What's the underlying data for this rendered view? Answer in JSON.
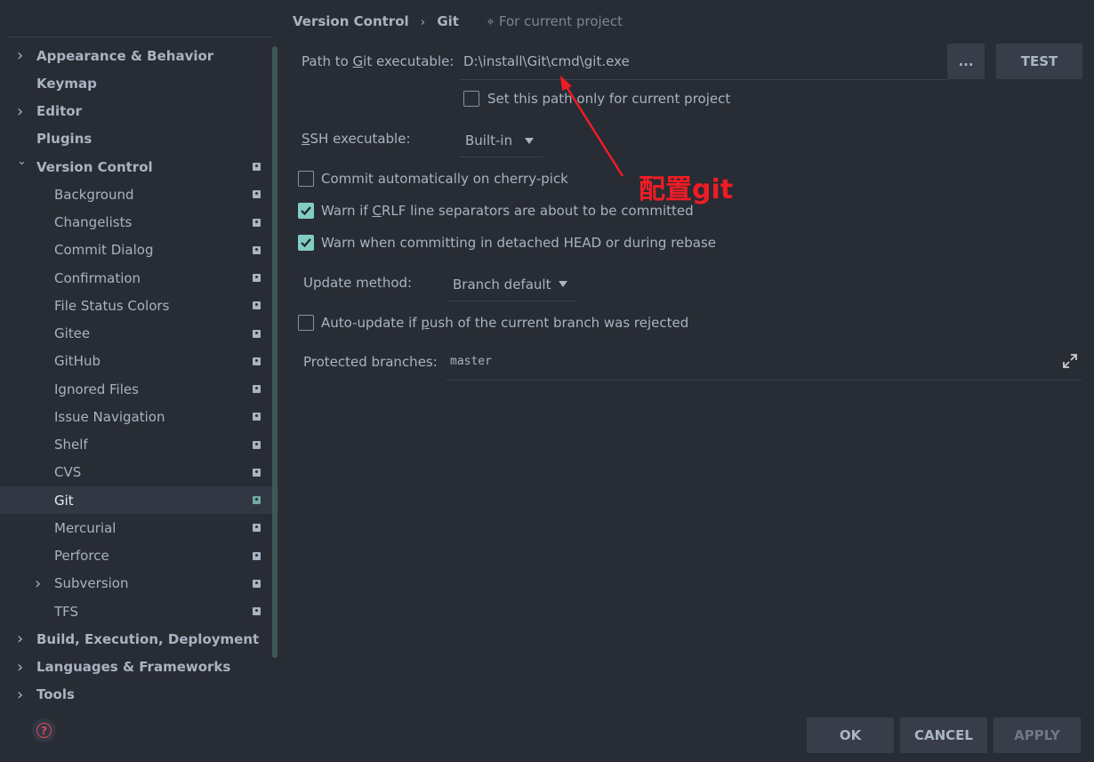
{
  "breadcrumb": {
    "parent": "Version Control",
    "separator": "›",
    "current": "Git",
    "scope": "For current project",
    "scope_icon": "project-scope-icon"
  },
  "sidebar": {
    "items": [
      {
        "label": "Appearance & Behavior",
        "level": 0,
        "chevron": "right"
      },
      {
        "label": "Keymap",
        "level": 0
      },
      {
        "label": "Editor",
        "level": 0,
        "chevron": "right"
      },
      {
        "label": "Plugins",
        "level": 0
      },
      {
        "label": "Version Control",
        "level": 0,
        "chevron": "down",
        "project": true
      },
      {
        "label": "Background",
        "level": 1,
        "project": true
      },
      {
        "label": "Changelists",
        "level": 1,
        "project": true
      },
      {
        "label": "Commit Dialog",
        "level": 1,
        "project": true
      },
      {
        "label": "Confirmation",
        "level": 1,
        "project": true
      },
      {
        "label": "File Status Colors",
        "level": 1,
        "project": true
      },
      {
        "label": "Gitee",
        "level": 1,
        "project": true
      },
      {
        "label": "GitHub",
        "level": 1,
        "project": true
      },
      {
        "label": "Ignored Files",
        "level": 1,
        "project": true
      },
      {
        "label": "Issue Navigation",
        "level": 1,
        "project": true
      },
      {
        "label": "Shelf",
        "level": 1,
        "project": true
      },
      {
        "label": "CVS",
        "level": 1,
        "project": true
      },
      {
        "label": "Git",
        "level": 1,
        "project": true,
        "selected": true
      },
      {
        "label": "Mercurial",
        "level": 1,
        "project": true
      },
      {
        "label": "Perforce",
        "level": 1,
        "project": true
      },
      {
        "label": "Subversion",
        "level": 1,
        "chevron": "right",
        "project": true
      },
      {
        "label": "TFS",
        "level": 1,
        "project": true
      },
      {
        "label": "Build, Execution, Deployment",
        "level": 0,
        "chevron": "right"
      },
      {
        "label": "Languages & Frameworks",
        "level": 0,
        "chevron": "right"
      },
      {
        "label": "Tools",
        "level": 0,
        "chevron": "right"
      }
    ]
  },
  "git": {
    "path_label_pre": "Path to ",
    "path_label_u": "G",
    "path_label_post": "it executable:",
    "path_value": "D:\\install\\Git\\cmd\\git.exe",
    "browse_label": "...",
    "test_label": "TEST",
    "set_path_label": "Set this path only for current project",
    "set_path_checked": false,
    "ssh_label_u": "S",
    "ssh_label_post": "SH executable:",
    "ssh_value": "Built-in",
    "cherry_pick_label": "Commit automatically on cherry-pick",
    "cherry_pick_checked": false,
    "crlf_pre": "Warn if ",
    "crlf_u": "C",
    "crlf_post": "RLF line separators are about to be committed",
    "crlf_checked": true,
    "detached_label": "Warn when committing in detached HEAD or during rebase",
    "detached_checked": true,
    "update_label": "Update method:",
    "update_value": "Branch default",
    "autoupdate_pre": "Auto-update if ",
    "autoupdate_u": "p",
    "autoupdate_post": "ush of the current branch was rejected",
    "autoupdate_checked": false,
    "protected_label": "Protected branches:",
    "protected_value": "master"
  },
  "annotation": {
    "text": "配置git",
    "color": "#ee1c25"
  },
  "footer": {
    "ok": "OK",
    "cancel": "CANCEL",
    "apply": "APPLY"
  },
  "colors": {
    "background": "#282c34",
    "accent": "#7fcdc4",
    "help": "#e0475c"
  }
}
